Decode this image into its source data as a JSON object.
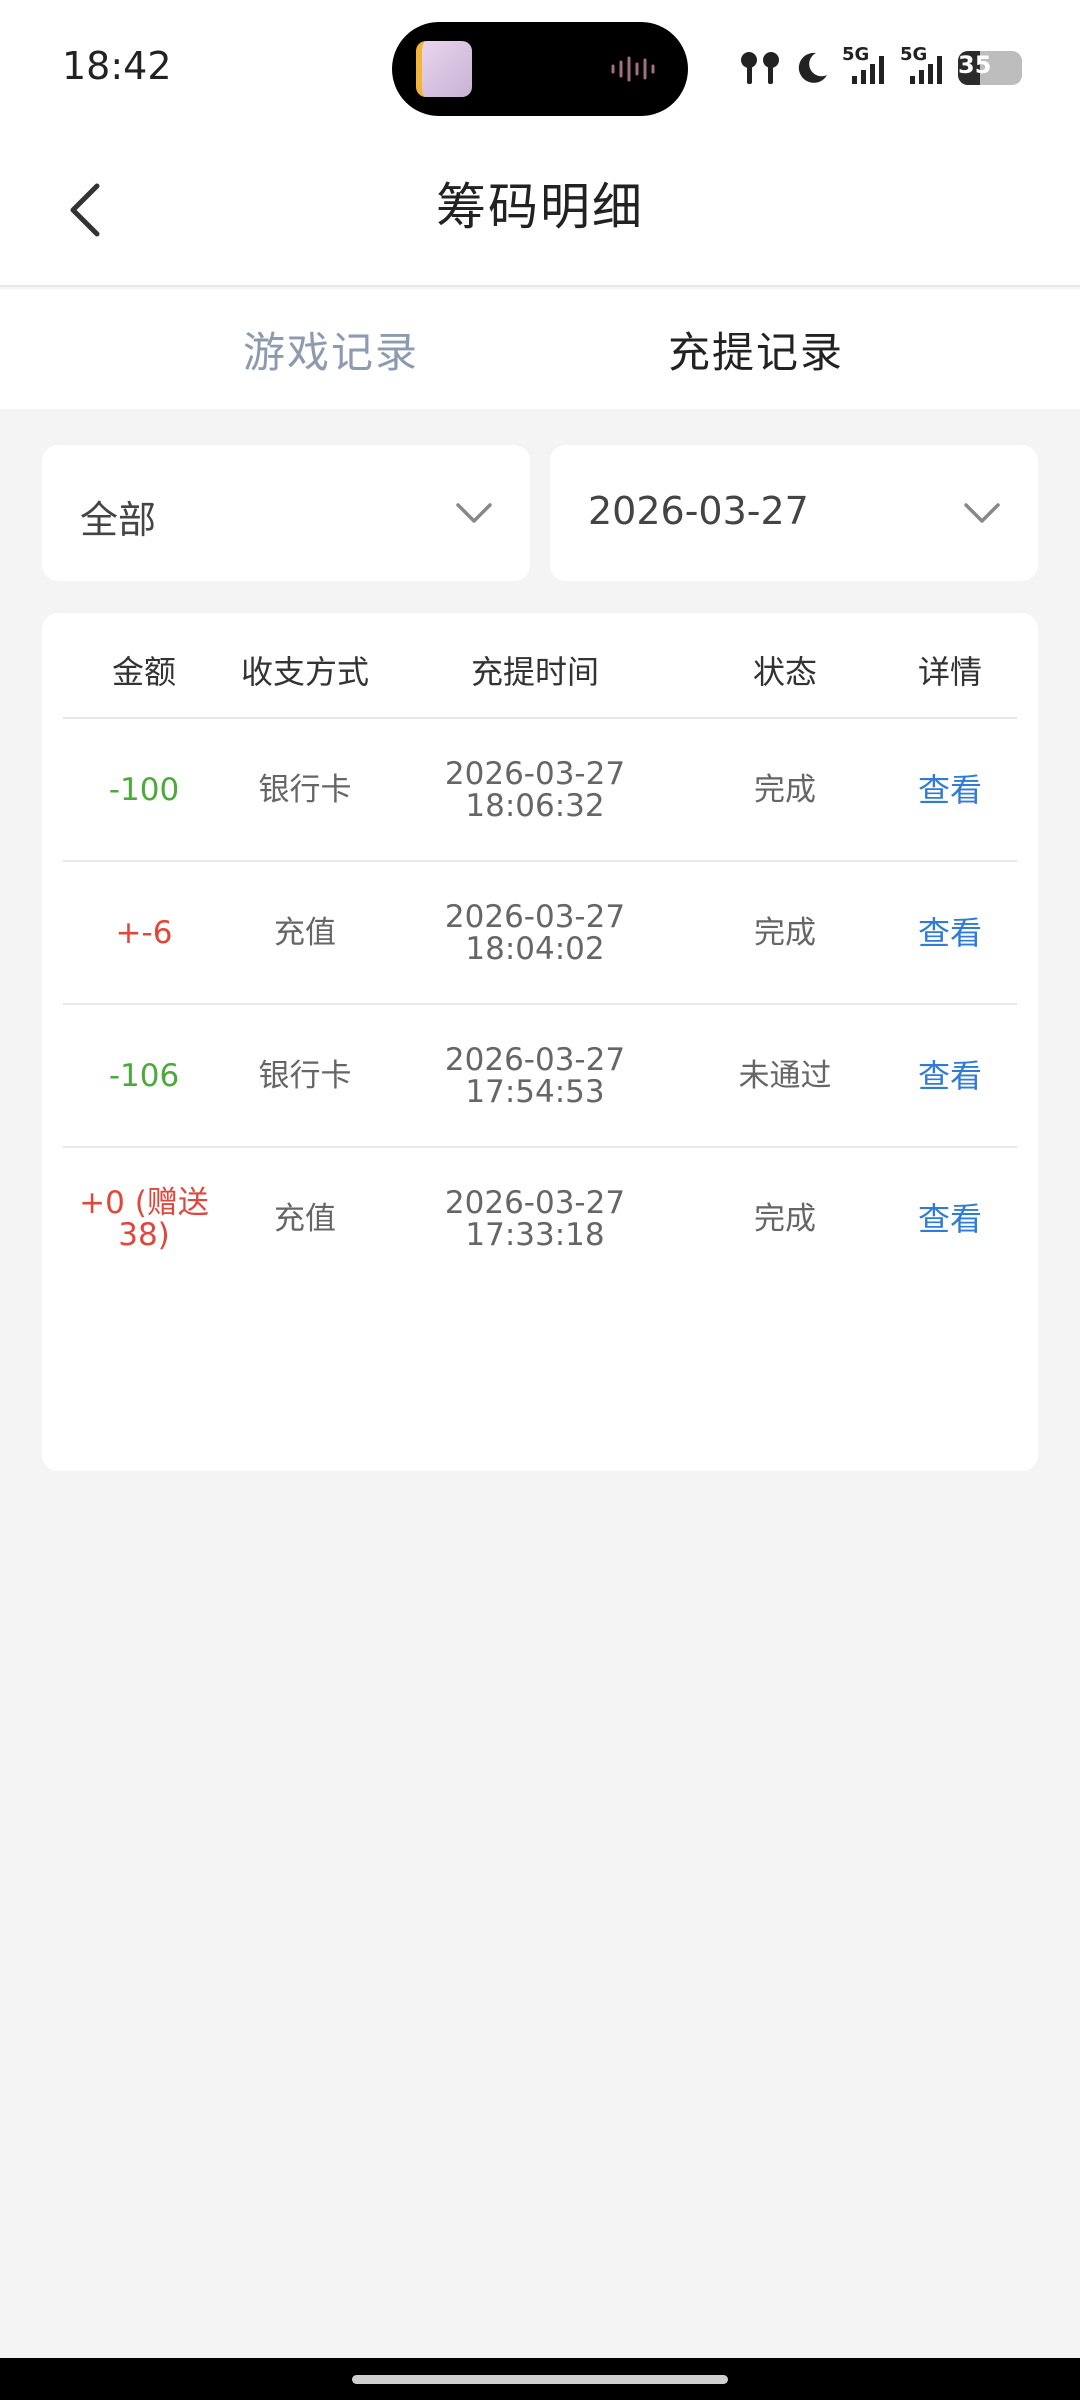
{
  "status_bar": {
    "time": "18:42",
    "network_1": "5G",
    "network_2": "5G",
    "battery": "35"
  },
  "header": {
    "title": "筹码明细"
  },
  "tabs": [
    {
      "label": "游戏记录",
      "active": false
    },
    {
      "label": "充提记录",
      "active": true
    }
  ],
  "filters": {
    "type": {
      "value": "全部"
    },
    "date": {
      "value": "2026-03-27"
    }
  },
  "table": {
    "columns": [
      "金额",
      "收支方式",
      "充提时间",
      "状态",
      "详情"
    ],
    "rows": [
      {
        "amount": "-100",
        "amount_sign": "negative",
        "method": "银行卡",
        "date": "2026-03-27",
        "time": "18:06:32",
        "status": "完成",
        "detail": "查看"
      },
      {
        "amount": "+-6",
        "amount_sign": "positive",
        "method": "充值",
        "date": "2026-03-27",
        "time": "18:04:02",
        "status": "完成",
        "detail": "查看"
      },
      {
        "amount": "-106",
        "amount_sign": "negative",
        "method": "银行卡",
        "date": "2026-03-27",
        "time": "17:54:53",
        "status": "未通过",
        "detail": "查看"
      },
      {
        "amount": "+0 (赠送38)",
        "amount_sign": "positive",
        "method": "充值",
        "date": "2026-03-27",
        "time": "17:33:18",
        "status": "完成",
        "detail": "查看"
      }
    ]
  },
  "colors": {
    "negative_amount": "#4caa3c",
    "positive_amount": "#e0463a",
    "link": "#2f7bd8",
    "inactive_tab": "#8e9ab0"
  }
}
